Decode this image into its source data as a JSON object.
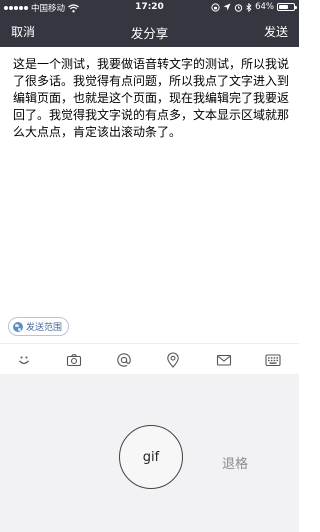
{
  "status_bar": {
    "carrier": "中国移动",
    "time": "17:20",
    "battery_percent": "64%",
    "battery_level": 0.64,
    "icons": [
      "signal-dots-icon",
      "wifi-icon",
      "lock-rotation-icon",
      "location-icon",
      "alarm-icon",
      "bluetooth-icon",
      "battery-icon"
    ]
  },
  "nav": {
    "cancel_label": "取消",
    "title": "发分享",
    "send_label": "发送"
  },
  "editor": {
    "text": "这是一个测试，我要做语音转文字的测试，所以我说了很多话。我觉得有点问题，所以我点了文字进入到编辑页面，也就是这个页面，现在我编辑完了我要返回了。我觉得我文字说的有点多，文本显示区域就那么大点点，肯定该出滚动条了。"
  },
  "scope": {
    "label": "发送范围",
    "icon": "globe-icon"
  },
  "toolbar": {
    "items": [
      "emoji-icon",
      "camera-icon",
      "at-icon",
      "location-pin-icon",
      "mail-icon",
      "keyboard-icon"
    ]
  },
  "voice_panel": {
    "gif_label": "gif",
    "backspace_label": "退格"
  },
  "colors": {
    "bar_background": "#34373f",
    "panel_background": "#f2f2f4",
    "scope_text": "#4a6a9a"
  }
}
